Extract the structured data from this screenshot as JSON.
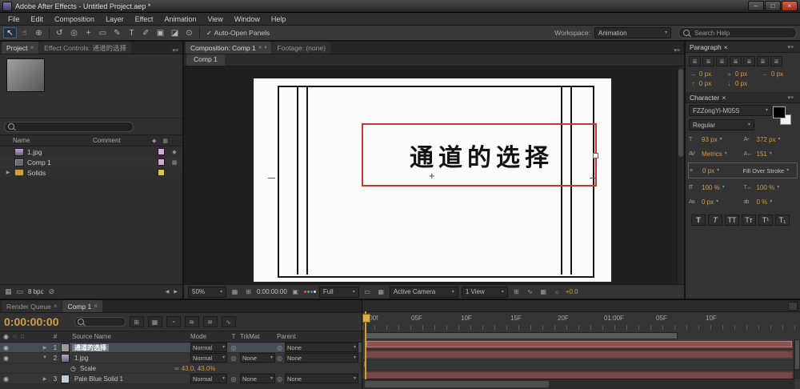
{
  "colors": {
    "accent_gold": "#d49c43",
    "timeline_bar": "#774747",
    "selection_red": "#c6382b"
  },
  "icons": {
    "close": "×",
    "dropdown_arrow": "▾",
    "panel_menu": "▾≡",
    "check": "✓",
    "eye": "◉",
    "pickwhip": "◎",
    "stopwatch": "◷",
    "expander_open": "▼",
    "expander_closed": "▶",
    "link": "∞",
    "minimize": "–",
    "maximize": "□",
    "cross": "+",
    "sun": "☼",
    "camera": "▣",
    "grid": "▦",
    "rect": "▭",
    "flow": "⊞",
    "graph": "∿",
    "wave": "≋",
    "shy": "◔",
    "diamond": "◆",
    "scroll_left": "◀",
    "scroll_right": "▶",
    "trash": "⊘",
    "align": "≣",
    "ibeam": "I"
  },
  "titlebar": {
    "title": "Adobe After Effects - Untitled Project.aep *"
  },
  "menubar": {
    "items": [
      "File",
      "Edit",
      "Composition",
      "Layer",
      "Effect",
      "Animation",
      "View",
      "Window",
      "Help"
    ]
  },
  "toolbar": {
    "tools": [
      {
        "glyph": "↖"
      },
      {
        "glyph": "☝"
      },
      {
        "glyph": "⊕"
      },
      {
        "glyph": "↺"
      },
      {
        "glyph": "◎"
      },
      {
        "glyph": "+"
      },
      {
        "glyph": "▭"
      },
      {
        "glyph": "✎"
      },
      {
        "glyph": "T"
      },
      {
        "glyph": "✐"
      },
      {
        "glyph": "▣"
      },
      {
        "glyph": "◪"
      },
      {
        "glyph": "⊙"
      }
    ],
    "auto_open_panels": "Auto-Open Panels",
    "workspace_label": "Workspace:",
    "workspace_value": "Animation",
    "search_placeholder": "Search Help"
  },
  "project_panel": {
    "tab_project": "Project",
    "tab_effect_controls": "Effect Controls: 通道的选择",
    "columns": {
      "name": "Name",
      "comment": "Comment"
    },
    "items": [
      {
        "name": "1.jpg"
      },
      {
        "name": "Comp 1"
      },
      {
        "name": "Solids"
      }
    ],
    "footer_bpc": "8 bpc"
  },
  "comp_panel": {
    "tab_composition": "Composition: Comp 1",
    "tab_footage": "Footage: (none)",
    "subtab": "Comp 1",
    "canvas_text": "通道的选择",
    "footer": {
      "zoom": "50%",
      "timecode": "0:00:00:00",
      "resolution": "Full",
      "camera": "Active Camera",
      "view": "1 View",
      "exposure": "+0.0"
    }
  },
  "paragraph_panel": {
    "title": "Paragraph",
    "indent_left": "0 px",
    "first_line_indent": "0 px",
    "indent_right": "0 px",
    "space_before": "0 px",
    "space_after": "0 px"
  },
  "character_panel": {
    "title": "Character",
    "font_family": "FZZongYi-M05S",
    "font_style": "Regular",
    "font_size": "93 px",
    "leading": "372 px",
    "kerning": "Metrics",
    "tracking": "151",
    "stroke_width": "0 px",
    "fill_mode": "Fill Over Stroke",
    "vertical_scale": "100 %",
    "horizontal_scale": "100 %",
    "baseline_shift": "0 px",
    "tsume": "0 %",
    "style_buttons": [
      "T",
      "T",
      "TT",
      "Tᴛ",
      "T¹",
      "T₁"
    ]
  },
  "timeline": {
    "tab_render_queue": "Render Queue",
    "tab_comp": "Comp 1",
    "timecode": "0:00:00:00",
    "columns": {
      "num": "#",
      "source": "Source Name",
      "mode": "Mode",
      "t": "T",
      "trkmat": "TrkMat",
      "parent": "Parent"
    },
    "layers": [
      {
        "num": "1",
        "name": "通道的选择",
        "mode": "Normal",
        "parent": "None"
      },
      {
        "num": "2",
        "name": "1.jpg",
        "mode": "Normal",
        "trkmat": "None",
        "parent": "None"
      },
      {
        "num": "3",
        "name": "Pale Blue Solid 1",
        "mode": "Normal",
        "trkmat": "None",
        "parent": "None"
      }
    ],
    "property_row": {
      "name": "Scale",
      "value": "43.0, 43.0%"
    },
    "ruler": [
      ":00f",
      "05F",
      "10F",
      "15F",
      "20F",
      "01:00F",
      "05F",
      "10F"
    ]
  }
}
